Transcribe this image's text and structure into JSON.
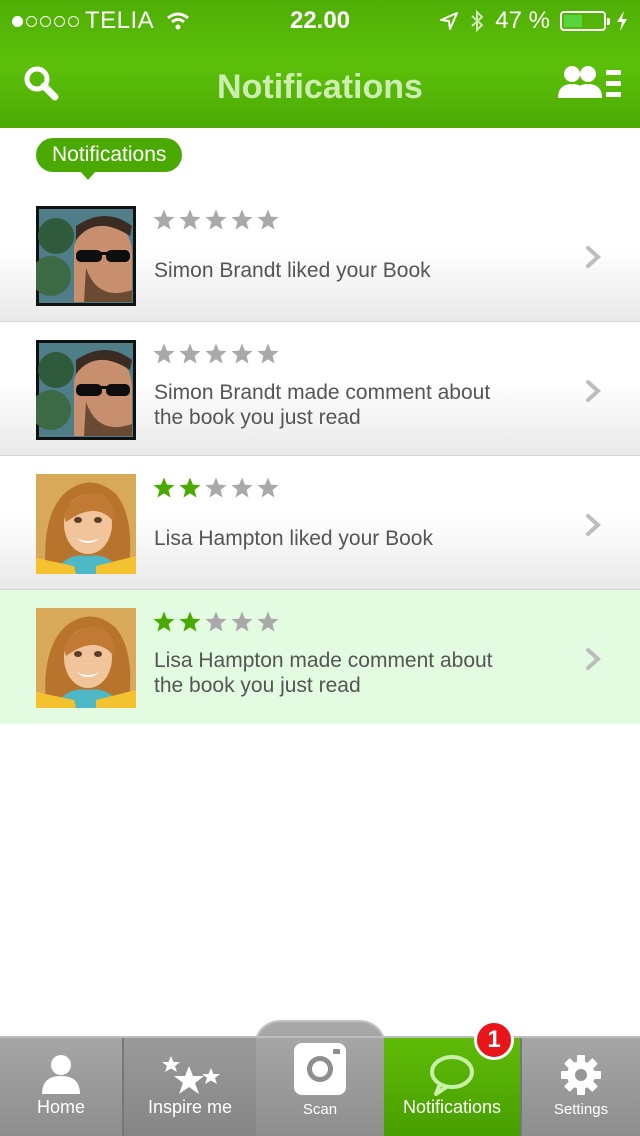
{
  "status_bar": {
    "carrier": "TELIA",
    "time": "22.00",
    "battery_text": "47 %",
    "battery_level": 0.47
  },
  "header": {
    "title": "Notifications"
  },
  "section": {
    "label": "Notifications"
  },
  "notifications": [
    {
      "user": "Simon Brandt",
      "line1": "Simon Brandt  liked your Book",
      "line2": "",
      "rating": 0,
      "highlighted": false
    },
    {
      "user": "Simon Brandt",
      "line1": "Simon Brandt  made comment about",
      "line2": "the book you just read",
      "rating": 0,
      "highlighted": false
    },
    {
      "user": "Lisa Hampton",
      "line1": "Lisa Hampton  liked your Book",
      "line2": "",
      "rating": 2,
      "highlighted": false
    },
    {
      "user": "Lisa Hampton",
      "line1": "Lisa Hampton  made comment about",
      "line2": "the book you just read",
      "rating": 2,
      "highlighted": true
    }
  ],
  "tabs": {
    "home": "Home",
    "inspire": "Inspire me",
    "scan": "Scan",
    "notifications": "Notifications",
    "settings": "Settings",
    "notifications_badge": "1"
  },
  "colors": {
    "brand_green": "#4aaa03",
    "star_on": "#4aaa03",
    "star_off": "#a9a9a9",
    "highlight_row": "#e3fbe0",
    "badge_red": "#e8161b"
  }
}
